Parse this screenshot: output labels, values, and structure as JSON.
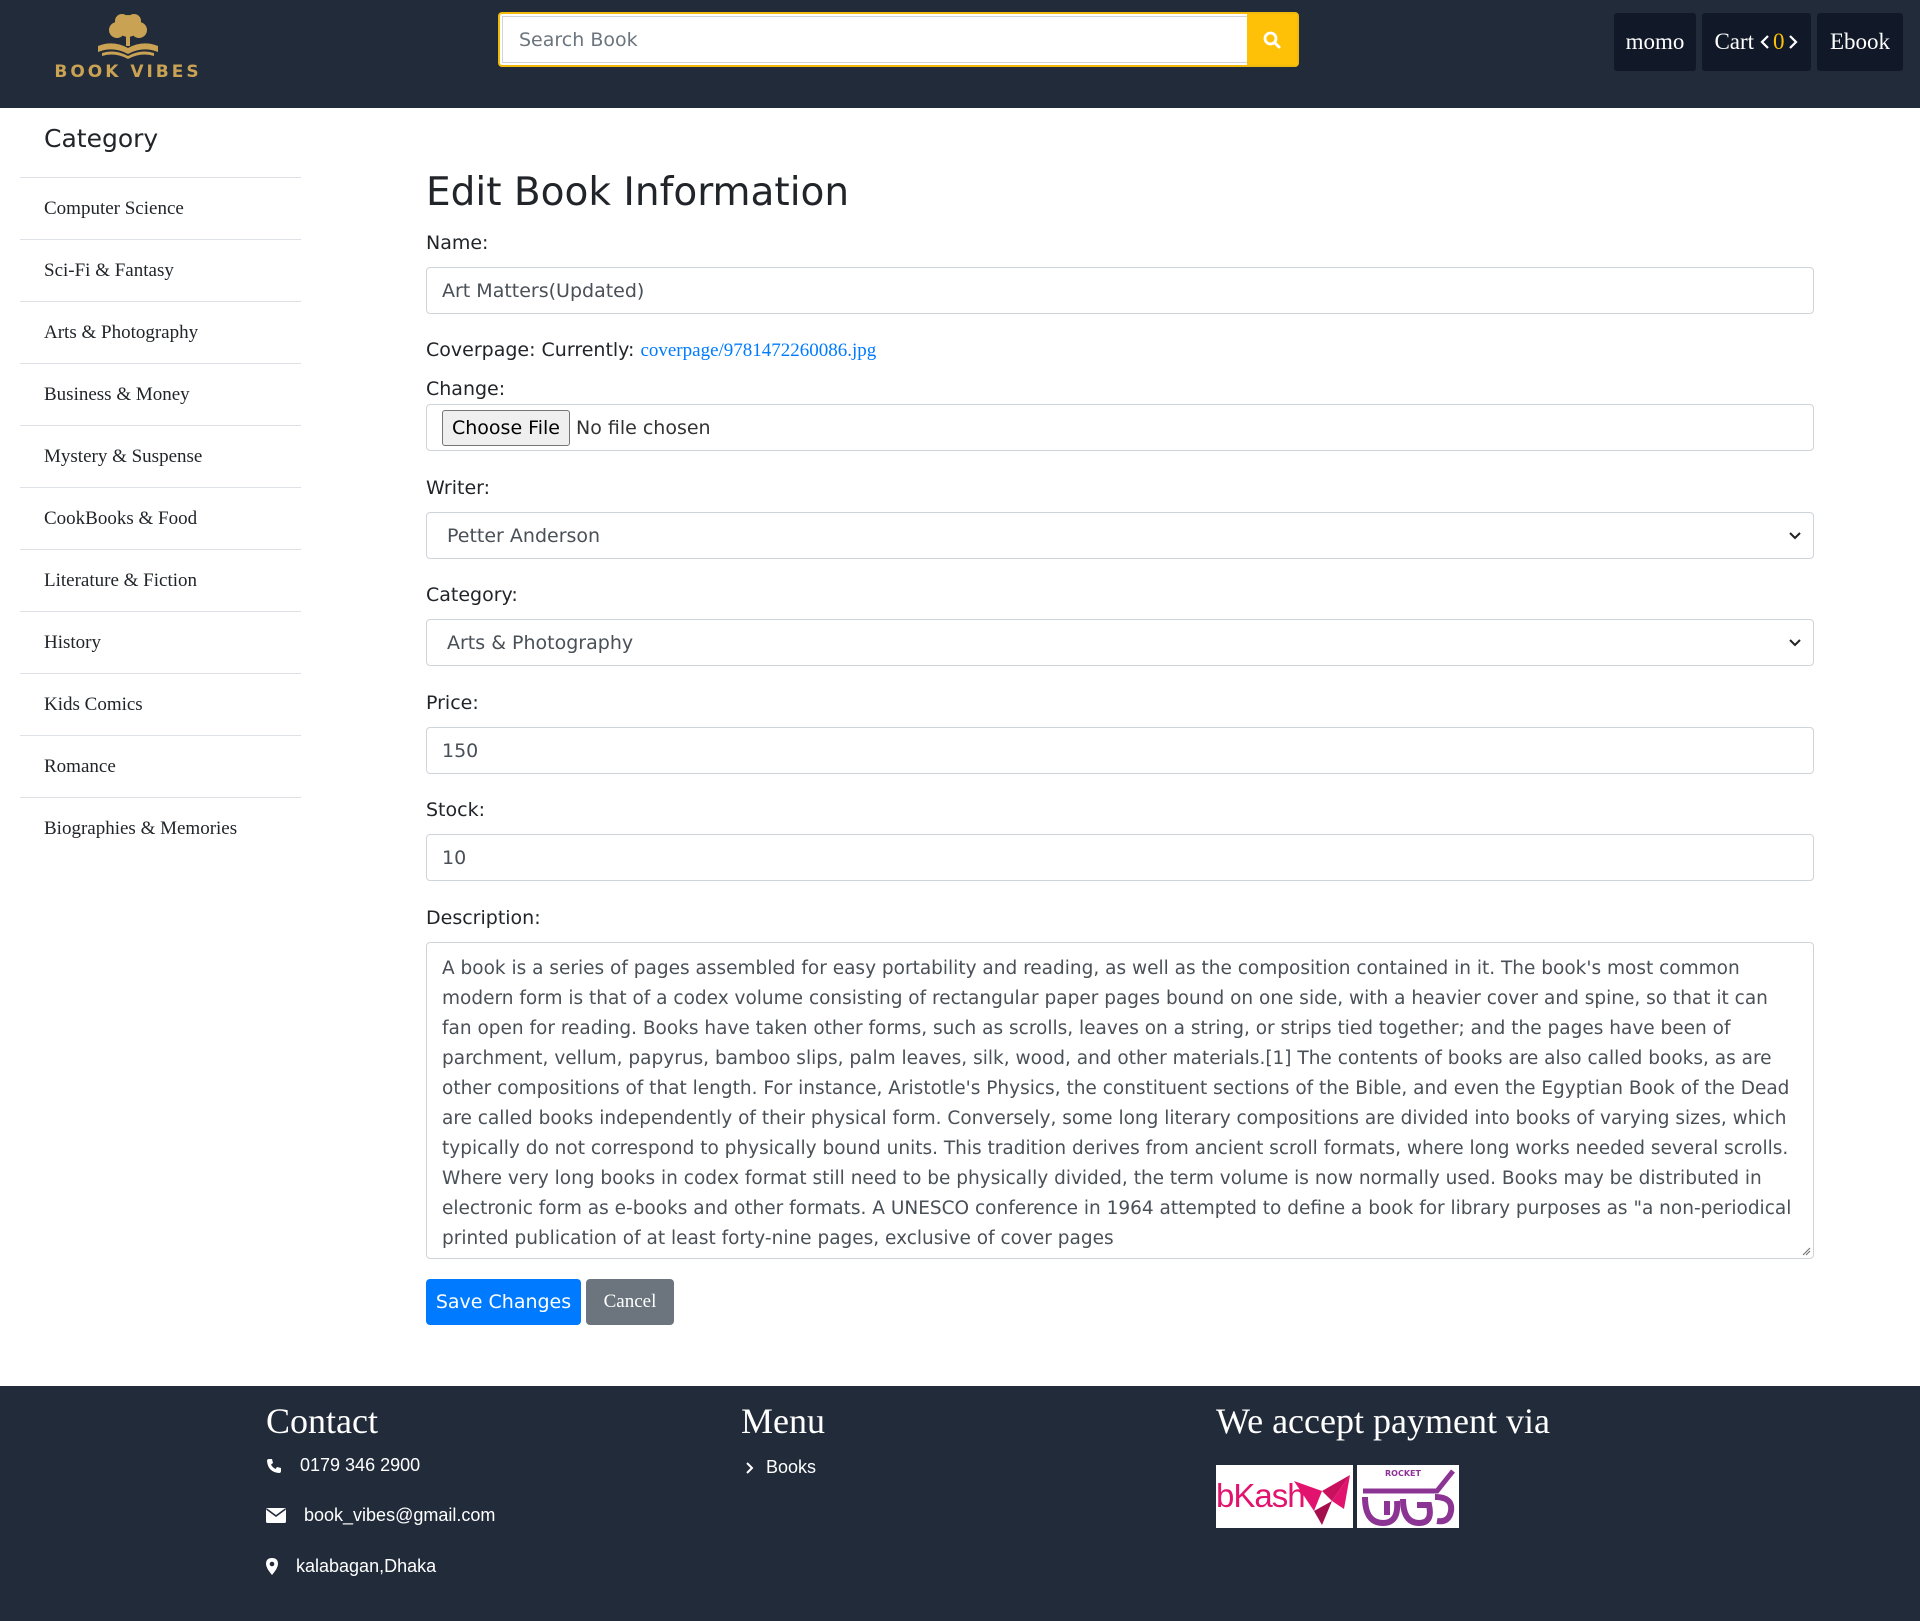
{
  "header": {
    "logo_text": "BOOK VIBES",
    "search_placeholder": "Search Book",
    "nav": {
      "user": "momo",
      "cart_label": "Cart",
      "cart_count": "0",
      "ebook": "Ebook"
    },
    "accent_color": "#ffc107",
    "bg_color": "#222b3a"
  },
  "sidebar": {
    "title": "Category",
    "items": [
      "Computer Science",
      "Sci-Fi & Fantasy",
      "Arts & Photography",
      "Business & Money",
      "Mystery & Suspense",
      "CookBooks & Food",
      "Literature & Fiction",
      "History",
      "Kids Comics",
      "Romance",
      "Biographies & Memories"
    ]
  },
  "form": {
    "title": "Edit Book Information",
    "name_label": "Name:",
    "name_value": "Art Matters(Updated)",
    "cover_label": "Coverpage: Currently:",
    "cover_link": "coverpage/9781472260086.jpg",
    "change_label": "Change:",
    "choose_file": "Choose File",
    "no_file": "No file chosen",
    "writer_label": "Writer:",
    "writer_value": "Petter Anderson",
    "category_label": "Category:",
    "category_value": "Arts & Photography",
    "price_label": "Price:",
    "price_value": "150",
    "stock_label": "Stock:",
    "stock_value": "10",
    "description_label": "Description:",
    "description": "A book is a series of pages assembled for easy portability and reading, as well as the composition contained in it. The book's most common modern form is that of a codex volume consisting of rectangular paper pages bound on one side, with a heavier cover and spine, so that it can fan open for reading. Books have taken other forms, such as scrolls, leaves on a string, or strips tied together; and the pages have been of parchment, vellum, papyrus, bamboo slips, palm leaves, silk, wood, and other materials.[1] The contents of books are also called books, as are other compositions of that length. For instance, Aristotle's Physics, the constituent sections of the Bible, and even the Egyptian Book of the Dead are called books independently of their physical form. Conversely, some long literary compositions are divided into books of varying sizes, which typically do not correspond to physically bound units. This tradition derives from ancient scroll formats, where long works needed several scrolls. Where very long books in codex format still need to be physically divided, the term volume is now normally used. Books may be distributed in electronic form as e-books and other formats. A UNESCO conference in 1964 attempted to define a book for library purposes as \"a non-periodical printed publication of at least forty-nine pages, exclusive of cover pages",
    "save_label": "Save Changes",
    "cancel_label": "Cancel",
    "primary_color": "#007bff",
    "secondary_color": "#6c757d"
  },
  "footer": {
    "contact_title": "Contact",
    "phone": "0179 346 2900",
    "email": "book_vibes@gmail.com",
    "address": "kalabagan,Dhaka",
    "menu_title": "Menu",
    "menu_items": [
      "Books"
    ],
    "payment_title": "We accept payment via",
    "payment_logos": [
      "bKash",
      "ROCKET"
    ]
  }
}
